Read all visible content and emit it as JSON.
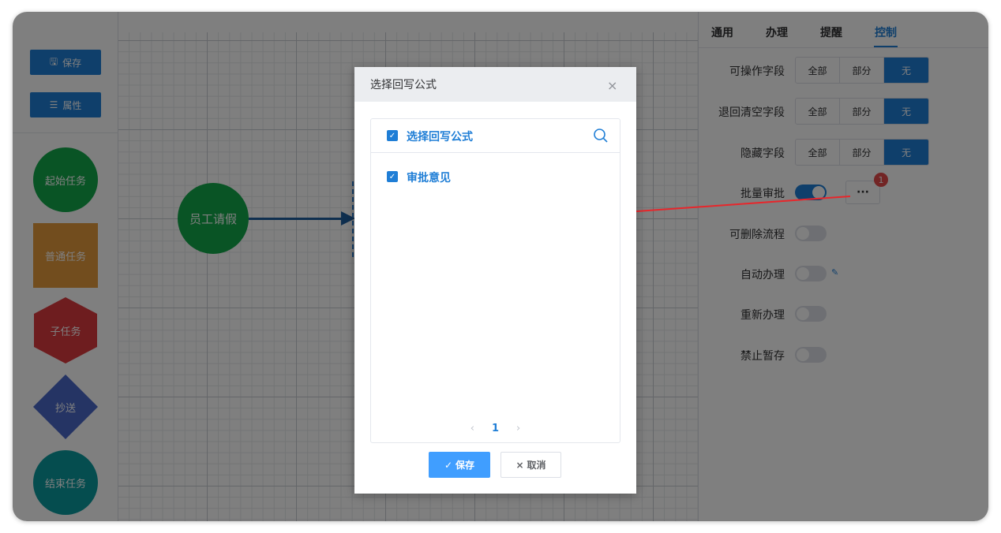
{
  "palette": {
    "save_label": "保存",
    "props_label": "属性",
    "shapes": [
      "起始任务",
      "普通任务",
      "子任务",
      "抄送",
      "结束任务"
    ]
  },
  "canvas": {
    "node_label": "员工请假"
  },
  "panel": {
    "tabs": [
      "通用",
      "办理",
      "提醒",
      "控制"
    ],
    "active_tab": "控制",
    "rows": {
      "operable_fields": "可操作字段",
      "return_clear_fields": "退回清空字段",
      "hidden_fields": "隐藏字段",
      "batch_approve": "批量审批",
      "deletable_flow": "可删除流程",
      "auto_handle": "自动办理",
      "rehandle": "重新办理",
      "forbid_draft": "禁止暂存"
    },
    "segment_options": [
      "全部",
      "部分",
      "无"
    ],
    "selected_option": "无",
    "more_button": "···",
    "badge_count": "1",
    "switches": {
      "batch_approve": true,
      "deletable_flow": false,
      "auto_handle": false,
      "rehandle": false,
      "forbid_draft": false
    }
  },
  "dialog": {
    "title": "选择回写公式",
    "close": "×",
    "list_header": "选择回写公式",
    "items": [
      "审批意见"
    ],
    "page": "1",
    "save_label": "保存",
    "cancel_label": "取消"
  },
  "colors": {
    "primary": "#1f7ed6",
    "start_green": "#13a84a",
    "annotation_red": "#e8262b"
  }
}
